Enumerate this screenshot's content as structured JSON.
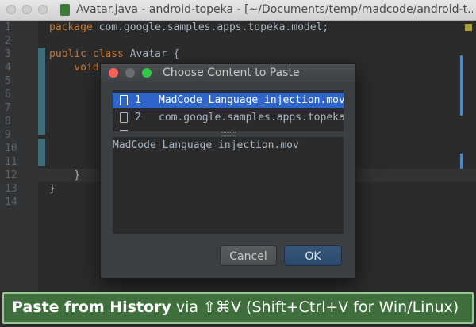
{
  "window": {
    "title": "Avatar.java - android-topeka - [~/Documents/temp/madcode/android-t..."
  },
  "editor": {
    "lines": [
      {
        "n": "1",
        "kw": "package",
        "rest": " com.google.samples.apps.topeka.model;"
      },
      {
        "n": "2",
        "kw": "",
        "rest": ""
      },
      {
        "n": "3",
        "kw": "public class",
        "rest": " Avatar {"
      },
      {
        "n": "4",
        "kw": "    void",
        "rest": ""
      },
      {
        "n": "5",
        "kw": "",
        "rest": ""
      },
      {
        "n": "6",
        "kw": "",
        "rest": ""
      },
      {
        "n": "7",
        "kw": "",
        "rest": ""
      },
      {
        "n": "8",
        "kw": "",
        "rest": ""
      },
      {
        "n": "9",
        "kw": "",
        "rest": ""
      },
      {
        "n": "10",
        "kw": "",
        "rest": ""
      },
      {
        "n": "11",
        "kw": "",
        "rest": ""
      },
      {
        "n": "12",
        "kw": "",
        "rest": "    }"
      },
      {
        "n": "13",
        "kw": "",
        "rest": "}"
      },
      {
        "n": "14",
        "kw": "",
        "rest": ""
      }
    ]
  },
  "dialog": {
    "title": "Choose Content to Paste",
    "items": [
      {
        "num": "1",
        "text": "MadCode_Language_injection.mov"
      },
      {
        "num": "2",
        "text": "com.google.samples.apps.topeka"
      }
    ],
    "preview": "MadCode_Language_injection.mov",
    "cancel_label": "Cancel",
    "ok_label": "OK"
  },
  "banner": {
    "bold": "Paste from History",
    "rest": " via ⇧⌘V (Shift+Ctrl+V for Win/Linux)"
  },
  "colors": {
    "selection": "#2f65ca",
    "banner_bg": "#3f6f3c",
    "keyword": "#cc7832"
  }
}
